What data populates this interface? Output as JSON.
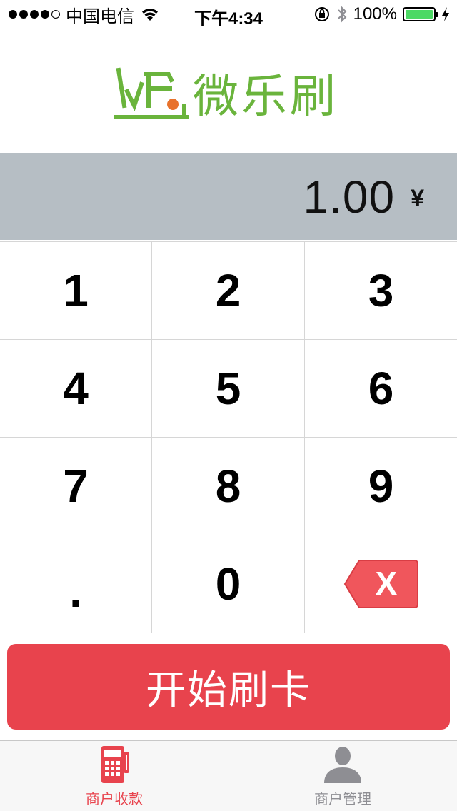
{
  "status_bar": {
    "carrier": "中国电信",
    "time": "下午4:34",
    "battery": "100%"
  },
  "logo": {
    "text": "微乐刷",
    "brand_color": "#6ab43c",
    "accent_color": "#e8722c"
  },
  "amount": {
    "value": "1.00",
    "currency": "¥"
  },
  "keypad": {
    "keys": [
      "1",
      "2",
      "3",
      "4",
      "5",
      "6",
      "7",
      "8",
      "9",
      ".",
      "0"
    ],
    "delete_label": "X"
  },
  "start_button": {
    "label": "开始刷卡",
    "color": "#e8434d"
  },
  "tab_bar": {
    "tabs": [
      {
        "label": "商户收款",
        "icon": "pos-terminal-icon",
        "active": true
      },
      {
        "label": "商户管理",
        "icon": "user-icon",
        "active": false
      }
    ]
  }
}
